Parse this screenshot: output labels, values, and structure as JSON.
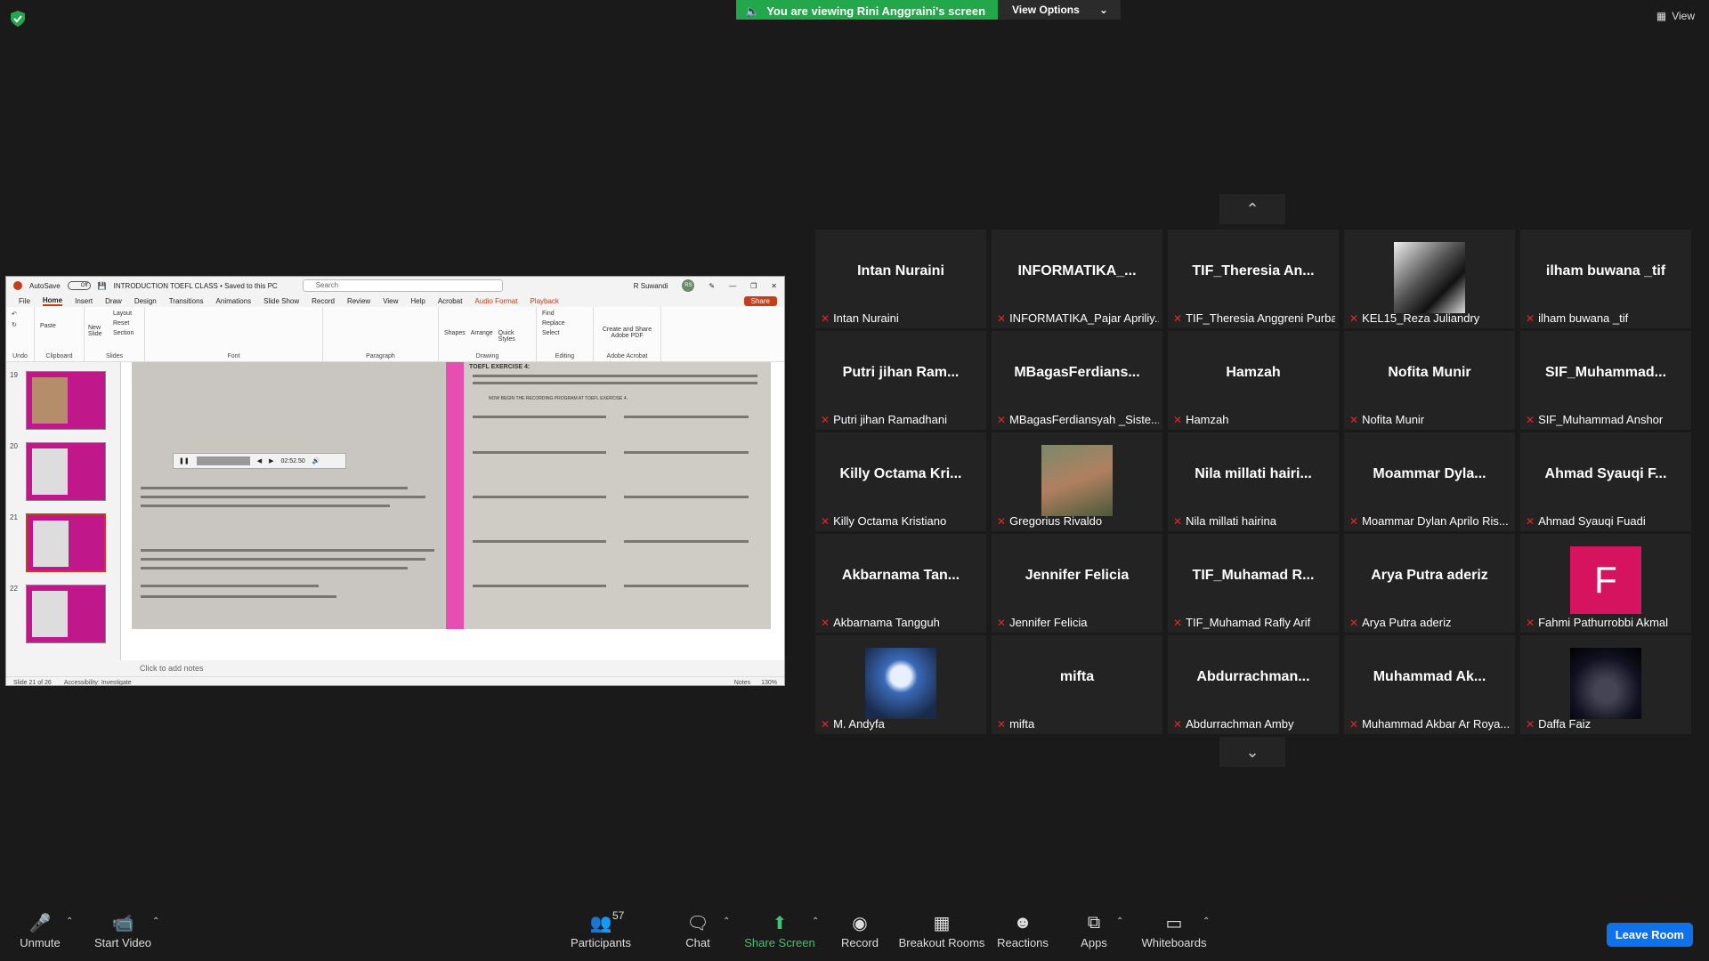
{
  "banner": {
    "viewing": "You are viewing Rini Anggraini's screen",
    "view_options": "View Options"
  },
  "view_label": "View",
  "ppt": {
    "autosave": "AutoSave",
    "toggle": "Off",
    "doc_title": "INTRODUCTION TOEFL CLASS • Saved to this PC",
    "search": "Search",
    "user": "R Suwandi",
    "user_initials": "RS",
    "tabs": [
      "File",
      "Home",
      "Insert",
      "Draw",
      "Design",
      "Transitions",
      "Animations",
      "Slide Show",
      "Record",
      "Review",
      "View",
      "Help",
      "Acrobat",
      "Audio Format",
      "Playback"
    ],
    "share": "Share",
    "groups": {
      "undo": "Undo",
      "clipboard": "Clipboard",
      "slides": "Slides",
      "font": "Font",
      "paragraph": "Paragraph",
      "drawing": "Drawing",
      "editing": "Editing",
      "acrobat": "Adobe Acrobat"
    },
    "buttons": {
      "paste": "Paste",
      "new_slide": "New Slide",
      "layout": "Layout",
      "reset": "Reset",
      "section": "Section",
      "shapes": "Shapes",
      "arrange": "Arrange",
      "quick_styles": "Quick Styles",
      "find": "Find",
      "replace": "Replace",
      "select": "Select",
      "create_pdf": "Create and Share Adobe PDF"
    },
    "thumb_numbers": [
      "19",
      "20",
      "21",
      "22"
    ],
    "player_time": "02:52.50",
    "notes": "Click to add notes",
    "status_slide": "Slide 21 of 26",
    "status_access": "Accessibility: Investigate",
    "status_notes": "Notes",
    "zoom": "130%",
    "exercise_left": "TOEFL EXERCISE 4:",
    "exercise_right_heading": "NOW BEGIN THE RECORDING PROGRAM AT TOEFL EXERCISE 4."
  },
  "participants": [
    {
      "big": "Intan Nuraini",
      "name": "Intan Nuraini"
    },
    {
      "big": "INFORMATIKA_...",
      "name": "INFORMATIKA_Pajar Apriliy..."
    },
    {
      "big": "TIF_Theresia An...",
      "name": "TIF_Theresia Anggreni Purba"
    },
    {
      "big": "",
      "name": "KEL15_Reza Juliandry",
      "photo": "cat"
    },
    {
      "big": "ilham buwana _tif",
      "name": "ilham buwana _tif"
    },
    {
      "big": "Putri jihan Ram...",
      "name": "Putri jihan Ramadhani"
    },
    {
      "big": "MBagasFerdians...",
      "name": "MBagasFerdiansyah _Siste..."
    },
    {
      "big": "Hamzah",
      "name": "Hamzah"
    },
    {
      "big": "Nofita Munir",
      "name": "Nofita Munir"
    },
    {
      "big": "SIF_Muhammad...",
      "name": "SIF_Muhammad Anshor"
    },
    {
      "big": "Killy Octama Kri...",
      "name": "Killy Octama Kristiano"
    },
    {
      "big": "",
      "name": "Gregorius Rivaldo",
      "photo": "person"
    },
    {
      "big": "Nila millati hairi...",
      "name": "Nila millati hairina"
    },
    {
      "big": "Moammar Dyla...",
      "name": "Moammar Dylan Aprilo Ris..."
    },
    {
      "big": "Ahmad Syauqi F...",
      "name": "Ahmad Syauqi Fuadi"
    },
    {
      "big": "Akbarnama Tan...",
      "name": "Akbarnama Tangguh"
    },
    {
      "big": "Jennifer Felicia",
      "name": "Jennifer Felicia"
    },
    {
      "big": "TIF_Muhamad R...",
      "name": "TIF_Muhamad Rafly Arif"
    },
    {
      "big": "Arya Putra aderiz",
      "name": "Arya Putra aderiz"
    },
    {
      "big": "",
      "name": "Fahmi Pathurrobbi Akmal",
      "letter": "F"
    },
    {
      "big": "",
      "name": "M. Andyfa",
      "photo": "moon"
    },
    {
      "big": "mifta",
      "name": "mifta"
    },
    {
      "big": "Abdurrachman...",
      "name": "Abdurrachman Amby"
    },
    {
      "big": "Muhammad Ak...",
      "name": "Muhammad Akbar Ar Roya..."
    },
    {
      "big": "",
      "name": "Daffa Faiz",
      "photo": "concert"
    }
  ],
  "toolbar": {
    "unmute": "Unmute",
    "start_video": "Start Video",
    "participants": "Participants",
    "participants_count": "57",
    "chat": "Chat",
    "share_screen": "Share Screen",
    "record": "Record",
    "breakout": "Breakout Rooms",
    "reactions": "Reactions",
    "apps": "Apps",
    "whiteboards": "Whiteboards",
    "leave": "Leave Room"
  },
  "colors": {
    "accent_green": "#22a84a",
    "leave_blue": "#0e72ed",
    "mute_red": "#e02828",
    "ppt_accent": "#c43e1c",
    "slide_pink": "#e64fb1"
  }
}
